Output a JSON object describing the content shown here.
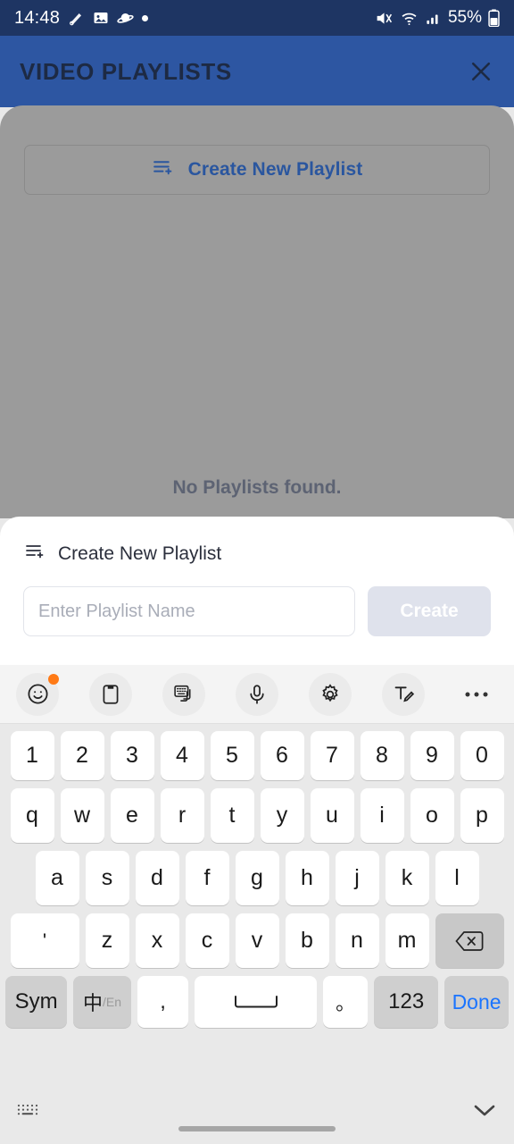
{
  "status_bar": {
    "time": "14:48",
    "left_icons": [
      "silent-mode-icon",
      "image-icon",
      "saturn-icon",
      "dot-indicator-icon"
    ],
    "right_icons": [
      "mute-icon",
      "wifi-icon",
      "signal-icon"
    ],
    "battery": "55%"
  },
  "app_header": {
    "title": "VIDEO PLAYLISTS",
    "close_icon": "close-icon",
    "background": "#2d56a2",
    "title_color": "#1d2a44"
  },
  "content": {
    "create_button": {
      "label": "Create New Playlist",
      "icon": "playlist-add-icon",
      "color": "#2a569f"
    },
    "empty_message": "No Playlists found.",
    "overlay_color": "#9b9b9b"
  },
  "sheet": {
    "heading": "Create New Playlist",
    "heading_icon": "playlist-add-icon",
    "input": {
      "value": "",
      "placeholder": "Enter Playlist Name"
    },
    "create_button": {
      "label": "Create",
      "disabled": true,
      "background": "#dfe2ec"
    }
  },
  "keyboard": {
    "toolbar": [
      {
        "name": "emoji-icon",
        "badge": true
      },
      {
        "name": "clipboard-icon",
        "badge": false
      },
      {
        "name": "translate-keyboard-icon",
        "badge": false
      },
      {
        "name": "microphone-icon",
        "badge": false
      },
      {
        "name": "gear-icon",
        "badge": false
      },
      {
        "name": "handwriting-icon",
        "badge": false
      },
      {
        "name": "more-options-icon",
        "badge": false
      }
    ],
    "row_numbers": [
      "1",
      "2",
      "3",
      "4",
      "5",
      "6",
      "7",
      "8",
      "9",
      "0"
    ],
    "row_top": [
      "q",
      "w",
      "e",
      "r",
      "t",
      "y",
      "u",
      "i",
      "o",
      "p"
    ],
    "row_home": [
      "a",
      "s",
      "d",
      "f",
      "g",
      "h",
      "j",
      "k",
      "l"
    ],
    "row_bottom_apostrophe": "'",
    "row_bottom": [
      "z",
      "x",
      "c",
      "v",
      "b",
      "n",
      "m"
    ],
    "backspace_icon": "backspace-icon",
    "function_row": {
      "sym": "Sym",
      "lang_main": "中",
      "lang_sep": "/",
      "lang_sub": "En",
      "comma": ",",
      "space_icon": "space-bar-icon",
      "period": "。",
      "numeric": "123",
      "done": "Done"
    },
    "footer": {
      "hide_keyboard_icon": "keyboard-dots-icon",
      "collapse_icon": "chevron-down-icon"
    }
  }
}
